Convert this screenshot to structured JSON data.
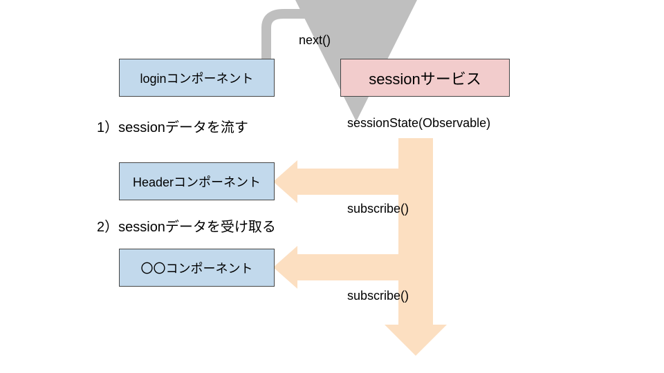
{
  "boxes": {
    "login": {
      "label": "loginコンポーネント"
    },
    "service": {
      "label": "sessionサービス"
    },
    "header": {
      "label": "Headerコンポーネント"
    },
    "other": {
      "label": "〇〇コンポーネント"
    }
  },
  "labels": {
    "next": "next()",
    "step1": "1）sessionデータを流す",
    "observable": "sessionState(Observable)",
    "step2": "2）sessionデータを受け取る",
    "subscribe1": "subscribe()",
    "subscribe2": "subscribe()"
  },
  "colors": {
    "blueFill": "#c2d9ec",
    "pinkFill": "#f2cccc",
    "flowFill": "#fcdfc1",
    "curlStroke": "#bfbfbf"
  }
}
